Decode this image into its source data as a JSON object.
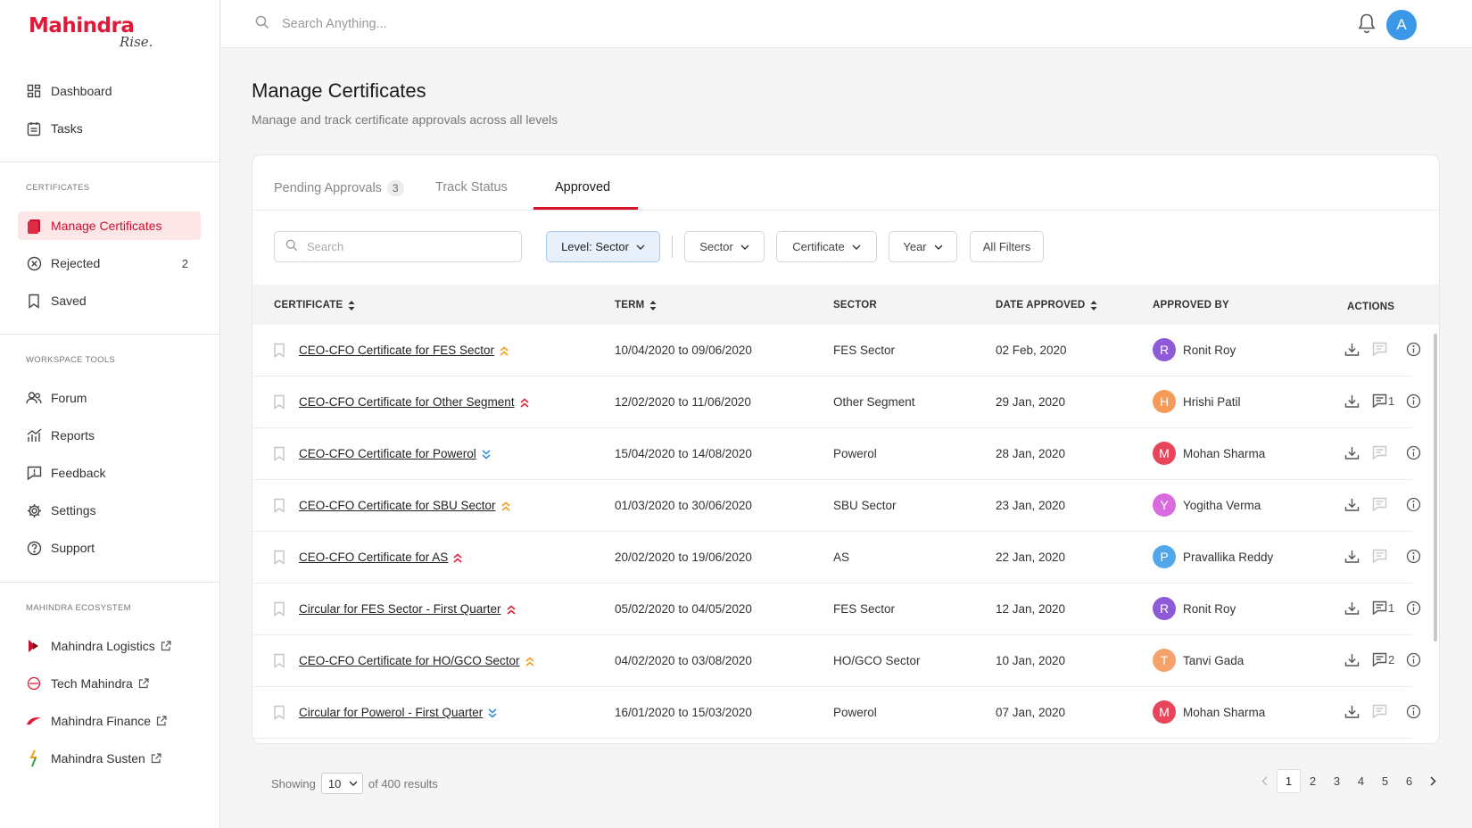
{
  "brand": {
    "name": "Mahindra",
    "tagline": "Rise."
  },
  "sidebar": {
    "primary": [
      {
        "label": "Dashboard",
        "icon": "dashboard-icon"
      },
      {
        "label": "Tasks",
        "icon": "tasks-icon"
      }
    ],
    "certificates_label": "CERTIFICATES",
    "certificates": [
      {
        "label": "Manage Certificates",
        "icon": "certificate-icon",
        "active": true
      },
      {
        "label": "Rejected",
        "icon": "rejected-icon",
        "count": "2"
      },
      {
        "label": "Saved",
        "icon": "bookmark-icon"
      }
    ],
    "tools_label": "WORKSPACE TOOLS",
    "tools": [
      {
        "label": "Forum",
        "icon": "forum-icon"
      },
      {
        "label": "Reports",
        "icon": "reports-icon"
      },
      {
        "label": "Feedback",
        "icon": "feedback-icon"
      },
      {
        "label": "Settings",
        "icon": "gear-icon"
      },
      {
        "label": "Support",
        "icon": "help-icon"
      }
    ],
    "ecosystem_label": "MAHINDRA ECOSYSTEM",
    "ecosystem": [
      {
        "label": "Mahindra Logistics",
        "icon": "logistics-logo-icon"
      },
      {
        "label": "Tech Mahindra",
        "icon": "tech-mahindra-logo-icon"
      },
      {
        "label": "Mahindra Finance",
        "icon": "finance-logo-icon"
      },
      {
        "label": "Mahindra Susten",
        "icon": "susten-logo-icon"
      }
    ]
  },
  "topbar": {
    "search_placeholder": "Search Anything...",
    "avatar_initial": "A"
  },
  "page": {
    "title": "Manage Certificates",
    "subtitle": "Manage and track certificate approvals across all levels"
  },
  "tabs": [
    {
      "label": "Pending Approvals",
      "badge": "3"
    },
    {
      "label": "Track Status"
    },
    {
      "label": "Approved",
      "active": true
    }
  ],
  "filters": {
    "search_placeholder": "Search",
    "level": "Level: Sector",
    "sector": "Sector",
    "certificate": "Certificate",
    "year": "Year",
    "all": "All Filters"
  },
  "table": {
    "headers": {
      "certificate": "CERTIFICATE",
      "term": "TERM",
      "sector": "SECTOR",
      "date_approved": "DATE APPROVED",
      "approved_by": "APPROVED BY",
      "actions": "ACTIONS"
    },
    "rows": [
      {
        "certificate": "CEO-CFO Certificate for FES Sector",
        "priority": "medium",
        "term": "10/04/2020 to 09/06/2020",
        "sector": "FES Sector",
        "date": "02 Feb, 2020",
        "approver": "Ronit Roy",
        "initial": "R",
        "color": "#8e5bd8",
        "comments": ""
      },
      {
        "certificate": "CEO-CFO Certificate for Other Segment",
        "priority": "high",
        "term": "12/02/2020 to 11/06/2020",
        "sector": "Other Segment",
        "date": "29 Jan, 2020",
        "approver": "Hrishi Patil",
        "initial": "H",
        "color": "#f59b5a",
        "comments": "1"
      },
      {
        "certificate": "CEO-CFO Certificate for Powerol",
        "priority": "low",
        "term": "15/04/2020 to 14/08/2020",
        "sector": "Powerol",
        "date": "28 Jan, 2020",
        "approver": "Mohan Sharma",
        "initial": "M",
        "color": "#e8445a",
        "comments": ""
      },
      {
        "certificate": "CEO-CFO Certificate for SBU Sector",
        "priority": "medium",
        "term": "01/03/2020 to 30/06/2020",
        "sector": "SBU Sector",
        "date": "23 Jan, 2020",
        "approver": "Yogitha Verma",
        "initial": "Y",
        "color": "#d86be0",
        "comments": ""
      },
      {
        "certificate": "CEO-CFO Certificate for AS",
        "priority": "high",
        "term": "20/02/2020 to 19/06/2020",
        "sector": "AS",
        "date": "22 Jan, 2020",
        "approver": "Pravallika Reddy",
        "initial": "P",
        "color": "#52a6ea",
        "comments": ""
      },
      {
        "certificate": "Circular for FES Sector - First Quarter",
        "priority": "high",
        "term": "05/02/2020 to 04/05/2020",
        "sector": "FES Sector",
        "date": "12 Jan, 2020",
        "approver": "Ronit Roy",
        "initial": "R",
        "color": "#8e5bd8",
        "comments": "1"
      },
      {
        "certificate": "CEO-CFO Certificate for HO/GCO Sector",
        "priority": "medium",
        "term": "04/02/2020 to 03/08/2020",
        "sector": "HO/GCO Sector",
        "date": "10 Jan, 2020",
        "approver": "Tanvi Gada",
        "initial": "T",
        "color": "#f5a36a",
        "comments": "2"
      },
      {
        "certificate": "Circular for Powerol - First Quarter",
        "priority": "low",
        "term": "16/01/2020 to 15/03/2020",
        "sector": "Powerol",
        "date": "07 Jan, 2020",
        "approver": "Mohan Sharma",
        "initial": "M",
        "color": "#e8445a",
        "comments": ""
      }
    ]
  },
  "pagination": {
    "showing_label": "Showing",
    "page_size": "10",
    "results_label": "of 400 results",
    "pages": [
      "1",
      "2",
      "3",
      "4",
      "5",
      "6"
    ],
    "current": "1"
  },
  "colors": {
    "accent": "#d4142b",
    "priority_high": "#e0243a",
    "priority_medium": "#f0a020",
    "priority_low": "#3a8fe0"
  }
}
